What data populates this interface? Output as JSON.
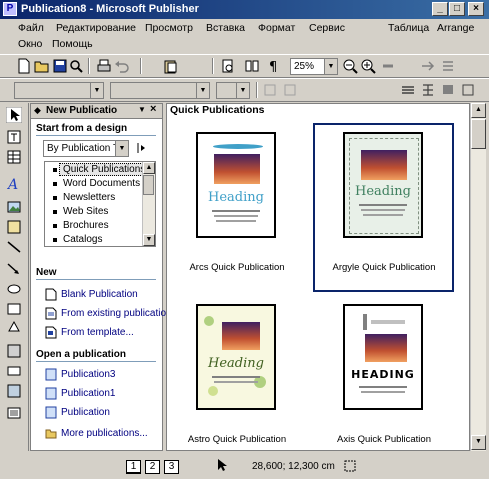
{
  "window": {
    "title": "Publication8 - Microsoft Publisher"
  },
  "menu": {
    "row1": [
      "Файл",
      "Редактирование",
      "Просмотр",
      "Вставка",
      "Формат",
      "Сервис",
      "Таблица",
      "Arrange"
    ],
    "row2": [
      "Окно",
      "Помощь"
    ]
  },
  "toolbar": {
    "zoom_value": "25%"
  },
  "taskpane": {
    "header": "New Publicatio",
    "start_heading": "Start from a design",
    "by_type_value": "By Publication Ty",
    "design_items": [
      "Quick Publications",
      "Word Documents",
      "Newsletters",
      "Web Sites",
      "Brochures",
      "Catalogs"
    ],
    "new_heading": "New",
    "new_links": [
      "Blank Publication",
      "From existing publicatio",
      "From template..."
    ],
    "open_heading": "Open a publication",
    "open_links": [
      "Publication3",
      "Publication1",
      "Publication",
      "More publications..."
    ]
  },
  "main": {
    "title": "Quick Publications",
    "thumbs": [
      {
        "caption": "Arcs Quick Publication",
        "heading": "Heading"
      },
      {
        "caption": "Argyle Quick Publication",
        "heading": "Heading"
      },
      {
        "caption": "Astro Quick Publication",
        "heading": "Heading"
      },
      {
        "caption": "Axis Quick Publication",
        "heading": "HEADING"
      }
    ]
  },
  "status": {
    "pages": [
      "1",
      "2",
      "3"
    ],
    "coords": "28,600; 12,300 cm"
  },
  "colors": {
    "title_bar": "#0a246a",
    "link": "#000080",
    "selection": "#0a246a"
  }
}
